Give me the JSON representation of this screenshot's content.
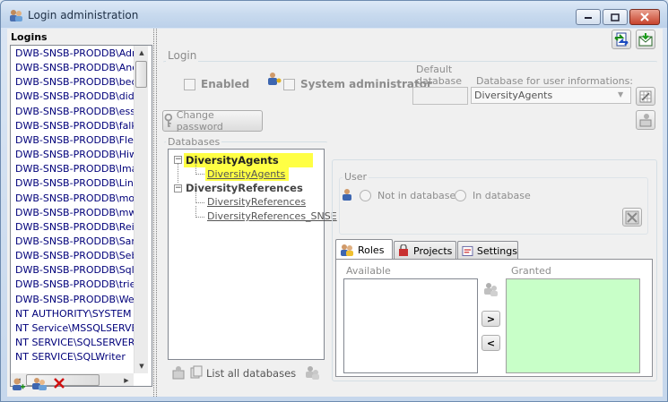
{
  "window": {
    "title": "Login administration"
  },
  "logins": {
    "label": "Logins",
    "items": [
      "DWB-SNSB-PRODDB\\Admi",
      "DWB-SNSB-PRODDB\\Andr",
      "DWB-SNSB-PRODDB\\beck",
      "DWB-SNSB-PRODDB\\didi",
      "DWB-SNSB-PRODDB\\esse",
      "DWB-SNSB-PRODDB\\falke",
      "DWB-SNSB-PRODDB\\Fleis",
      "DWB-SNSB-PRODDB\\Hiwi",
      "DWB-SNSB-PRODDB\\Imag",
      "DWB-SNSB-PRODDB\\Link",
      "DWB-SNSB-PRODDB\\mont",
      "DWB-SNSB-PRODDB\\mwe",
      "DWB-SNSB-PRODDB\\Reic",
      "DWB-SNSB-PRODDB\\Sanz",
      "DWB-SNSB-PRODDB\\Sebe",
      "DWB-SNSB-PRODDB\\SqlS",
      "DWB-SNSB-PRODDB\\triebe",
      "DWB-SNSB-PRODDB\\Weib",
      "NT AUTHORITY\\SYSTEM",
      "NT Service\\MSSQLSERVER",
      "NT SERVICE\\SQLSERVERA",
      "NT SERVICE\\SQLWriter"
    ]
  },
  "login": {
    "group_title": "Login",
    "enabled_label": "Enabled",
    "sysadmin_label": "System administrator",
    "default_db_label": "Default database",
    "default_db_value": "",
    "userinfo_db_label": "Database for user informations:",
    "userinfo_db_value": "DiversityAgents",
    "change_password_label": "Change password"
  },
  "databases": {
    "group_title": "Databases",
    "tree": [
      {
        "label": "DiversityAgents",
        "bold": true,
        "highlight": true
      },
      {
        "label": "DiversityAgents",
        "bold": false,
        "highlight": true,
        "child": true
      },
      {
        "label": "DiversityReferences",
        "bold": true,
        "highlight": false
      },
      {
        "label": "DiversityReferences",
        "bold": false,
        "highlight": false,
        "child": true
      },
      {
        "label": "DiversityReferences_SNSE",
        "bold": false,
        "highlight": false,
        "child": true
      }
    ],
    "list_all_label": "List all databases"
  },
  "user": {
    "group_title": "User",
    "not_in_db_label": "Not in database",
    "in_db_label": "In database"
  },
  "tabs": {
    "roles": "Roles",
    "projects": "Projects",
    "settings": "Settings"
  },
  "roles": {
    "available_label": "Available",
    "granted_label": "Granted",
    "add_symbol": ">",
    "remove_symbol": "<"
  },
  "colors": {
    "highlight": "#ffff44",
    "granted_bg": "#c8ffc8",
    "link_blue": "#00007a"
  }
}
